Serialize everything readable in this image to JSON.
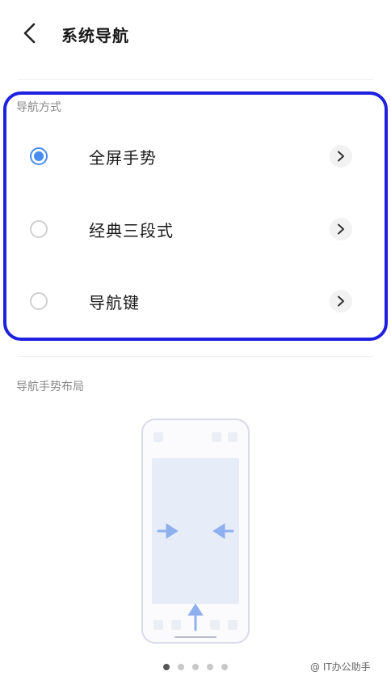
{
  "header": {
    "title": "系统导航"
  },
  "navigation_mode": {
    "section_label": "导航方式",
    "options": [
      {
        "label": "全屏手势",
        "selected": true
      },
      {
        "label": "经典三段式",
        "selected": false
      },
      {
        "label": "导航键",
        "selected": false
      }
    ]
  },
  "gesture_layout": {
    "section_label": "导航手势布局",
    "pager_dots": 5,
    "active_dot": 1
  },
  "watermark": {
    "text": "@ IT办公助手"
  },
  "colors": {
    "accent": "#4a8bf0",
    "highlight_box": "#1f1fe0",
    "preview_fill": "#e7ecf9",
    "preview_arrow": "#8fb0ef"
  }
}
